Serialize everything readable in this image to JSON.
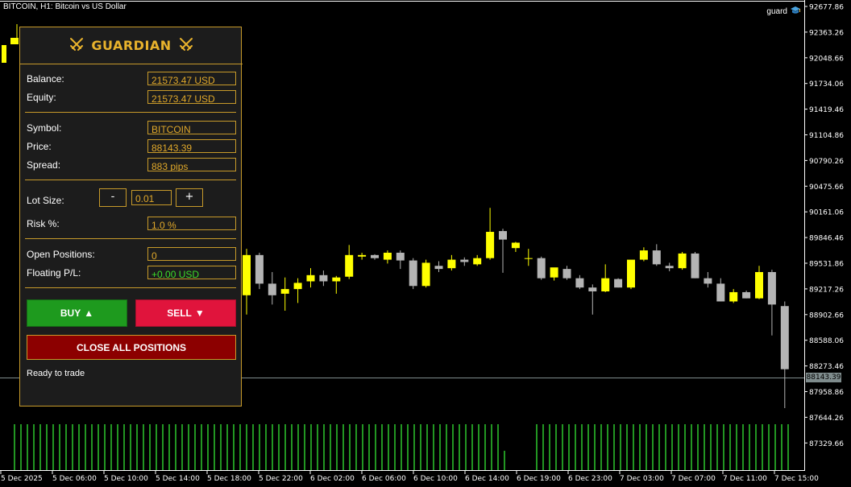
{
  "chart": {
    "title": "BITCOIN, H1:  Bitcoin vs US Dollar",
    "ea_name": "guard",
    "current_price_tag": "88143.39",
    "price_labels": [
      "92677.86",
      "92363.26",
      "92048.66",
      "91734.06",
      "91419.46",
      "91104.86",
      "90790.26",
      "90475.66",
      "90161.06",
      "89846.46",
      "89531.86",
      "89217.26",
      "88902.66",
      "88588.06",
      "88273.46",
      "87958.86",
      "87644.26",
      "87329.66"
    ],
    "time_labels": [
      "5 Dec 2025",
      "5 Dec 06:00",
      "5 Dec 10:00",
      "5 Dec 14:00",
      "5 Dec 18:00",
      "5 Dec 22:00",
      "6 Dec 02:00",
      "6 Dec 06:00",
      "6 Dec 10:00",
      "6 Dec 14:00",
      "6 Dec 19:00",
      "6 Dec 23:00",
      "7 Dec 03:00",
      "7 Dec 07:00",
      "7 Dec 11:00",
      "7 Dec 15:00"
    ],
    "colors": {
      "bull": "#ffff00",
      "bear": "#b4b4b4",
      "volume": "#2ec82e",
      "grid_line": "#7f8c8d"
    }
  },
  "chart_data": {
    "type": "candlestick",
    "symbol": "BITCOIN",
    "timeframe": "H1",
    "candles": [
      {
        "o": 89100,
        "h": 89700,
        "l": 88850,
        "c": 89620
      },
      {
        "o": 89620,
        "h": 89650,
        "l": 89180,
        "c": 89250
      },
      {
        "o": 89250,
        "h": 89400,
        "l": 88980,
        "c": 89100
      },
      {
        "o": 89120,
        "h": 89330,
        "l": 88900,
        "c": 89180
      },
      {
        "o": 89180,
        "h": 89320,
        "l": 89000,
        "c": 89260
      },
      {
        "o": 89280,
        "h": 89450,
        "l": 89200,
        "c": 89360
      },
      {
        "o": 89360,
        "h": 89420,
        "l": 89220,
        "c": 89280
      },
      {
        "o": 89280,
        "h": 89350,
        "l": 89120,
        "c": 89330
      },
      {
        "o": 89340,
        "h": 89750,
        "l": 89310,
        "c": 89620
      },
      {
        "o": 89600,
        "h": 89650,
        "l": 89560,
        "c": 89620
      },
      {
        "o": 89620,
        "h": 89630,
        "l": 89560,
        "c": 89580
      },
      {
        "o": 89560,
        "h": 89680,
        "l": 89510,
        "c": 89650
      },
      {
        "o": 89650,
        "h": 89680,
        "l": 89440,
        "c": 89550
      },
      {
        "o": 89550,
        "h": 89580,
        "l": 89180,
        "c": 89220
      },
      {
        "o": 89220,
        "h": 89560,
        "l": 89200,
        "c": 89520
      },
      {
        "o": 89480,
        "h": 89540,
        "l": 89400,
        "c": 89440
      },
      {
        "o": 89450,
        "h": 89620,
        "l": 89420,
        "c": 89560
      },
      {
        "o": 89560,
        "h": 89590,
        "l": 89480,
        "c": 89530
      },
      {
        "o": 89500,
        "h": 89620,
        "l": 89480,
        "c": 89580
      },
      {
        "o": 89580,
        "h": 90230,
        "l": 89560,
        "c": 89920
      },
      {
        "o": 89930,
        "h": 89960,
        "l": 89390,
        "c": 89820
      },
      {
        "o": 89710,
        "h": 89790,
        "l": 89660,
        "c": 89780
      },
      {
        "o": 89580,
        "h": 89700,
        "l": 89480,
        "c": 89580
      },
      {
        "o": 89580,
        "h": 89600,
        "l": 89300,
        "c": 89320
      },
      {
        "o": 89330,
        "h": 89440,
        "l": 89290,
        "c": 89460
      },
      {
        "o": 89440,
        "h": 89480,
        "l": 89300,
        "c": 89320
      },
      {
        "o": 89320,
        "h": 89360,
        "l": 89180,
        "c": 89200
      },
      {
        "o": 89200,
        "h": 89240,
        "l": 88850,
        "c": 89150
      },
      {
        "o": 89150,
        "h": 89500,
        "l": 89140,
        "c": 89320
      },
      {
        "o": 89310,
        "h": 89320,
        "l": 89200,
        "c": 89200
      },
      {
        "o": 89200,
        "h": 89540,
        "l": 89180,
        "c": 89560
      },
      {
        "o": 89560,
        "h": 89720,
        "l": 89540,
        "c": 89680
      },
      {
        "o": 89680,
        "h": 89760,
        "l": 89480,
        "c": 89500
      },
      {
        "o": 89480,
        "h": 89520,
        "l": 89410,
        "c": 89450
      },
      {
        "o": 89450,
        "h": 89660,
        "l": 89430,
        "c": 89640
      },
      {
        "o": 89640,
        "h": 89660,
        "l": 89320,
        "c": 89320
      },
      {
        "o": 89320,
        "h": 89400,
        "l": 89200,
        "c": 89250
      },
      {
        "o": 89250,
        "h": 89320,
        "l": 89020,
        "c": 89020
      },
      {
        "o": 89020,
        "h": 89180,
        "l": 89000,
        "c": 89140
      },
      {
        "o": 89140,
        "h": 89160,
        "l": 89060,
        "c": 89060
      },
      {
        "o": 89060,
        "h": 89480,
        "l": 89050,
        "c": 89400
      },
      {
        "o": 89400,
        "h": 89430,
        "l": 88580,
        "c": 88980
      },
      {
        "o": 88960,
        "h": 89020,
        "l": 87640,
        "c": 88143.39
      }
    ],
    "volume": {
      "colors": "#2ec82e",
      "values": [
        1,
        1,
        1,
        1,
        1,
        1,
        1,
        1,
        1,
        1,
        1,
        1,
        1,
        1,
        1,
        1,
        1,
        1,
        1,
        1,
        1,
        1,
        1,
        1,
        1,
        1,
        1,
        1,
        1,
        1,
        1,
        1,
        1,
        1,
        1,
        1,
        1,
        1,
        1,
        1,
        1,
        1,
        1,
        1,
        1,
        1,
        1,
        1,
        1,
        1,
        1,
        1,
        1,
        1,
        1,
        1,
        1,
        1,
        1,
        1,
        1,
        1,
        1,
        1,
        1,
        1,
        1,
        1,
        1,
        1,
        1,
        1,
        1,
        1,
        1,
        1,
        1,
        1,
        1,
        1,
        1,
        1,
        1,
        1,
        1,
        1,
        1,
        1,
        1,
        1,
        1,
        1,
        1,
        1,
        1,
        1,
        1,
        1,
        1,
        1,
        1,
        1,
        1,
        1,
        1,
        1,
        1,
        1,
        1,
        1,
        1,
        1,
        1,
        1,
        1,
        1,
        1,
        1,
        1,
        1,
        1,
        1,
        1,
        1
      ]
    },
    "ylim": [
      87172,
      92835
    ]
  },
  "panel": {
    "title": "GUARDIAN",
    "balance_label": "Balance:",
    "balance_value": "21573.47 USD",
    "equity_label": "Equity:",
    "equity_value": "21573.47 USD",
    "symbol_label": "Symbol:",
    "symbol_value": "BITCOIN",
    "price_label": "Price:",
    "price_value": "88143.39",
    "spread_label": "Spread:",
    "spread_value": "883 pips",
    "lot_label": "Lot Size:",
    "lot_minus": "-",
    "lot_value": "0.01",
    "lot_plus": "+",
    "risk_label": "Risk %:",
    "risk_value": "1.0 %",
    "open_label": "Open Positions:",
    "open_value": "0",
    "pl_label": "Floating P/L:",
    "pl_value": "+0.00 USD",
    "buy_label": "BUY",
    "buy_arrow": "▲",
    "sell_label": "SELL",
    "sell_arrow": "▼",
    "close_all_label": "CLOSE ALL POSITIONS",
    "status": "Ready to trade",
    "colors": {
      "accent": "#c79a2a",
      "title": "#e8b22c",
      "buy": "#1e9a1e",
      "sell": "#e0143c",
      "close_all": "#8c0000",
      "profit": "#3cdc2a"
    },
    "icons": {
      "title_left": "crossed-swords-icon",
      "title_right": "crossed-swords-icon"
    }
  }
}
